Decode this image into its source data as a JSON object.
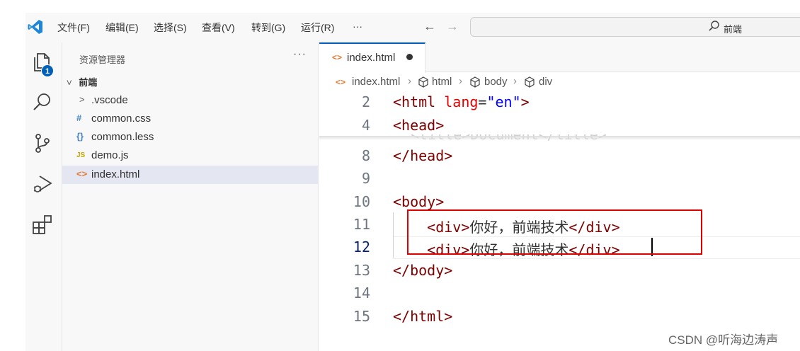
{
  "menu": [
    "文件(F)",
    "编辑(E)",
    "选择(S)",
    "查看(V)",
    "转到(G)",
    "运行(R)",
    "···"
  ],
  "nav": {
    "back": "←",
    "forward": "→"
  },
  "search": {
    "text": "前端"
  },
  "activity": {
    "explorer_badge": "1"
  },
  "sidebar": {
    "title": "资源管理器",
    "more": "···",
    "folder": "前端",
    "items": [
      {
        "icon": ">",
        "label": ".vscode",
        "icon_color": "#555555"
      },
      {
        "icon": "#",
        "label": "common.css",
        "icon_color": "#4a86c7"
      },
      {
        "icon": "{}",
        "label": "common.less",
        "icon_color": "#4a86c7"
      },
      {
        "icon": "JS",
        "label": "demo.js",
        "icon_color": "#c5a300"
      },
      {
        "icon": "<>",
        "label": "index.html",
        "icon_color": "#e37933"
      }
    ]
  },
  "tab": {
    "label": "index.html"
  },
  "breadcrumb": [
    "index.html",
    "html",
    "body",
    "div"
  ],
  "code": {
    "ghost": "<title>Document</title>",
    "lines": [
      {
        "n": "2",
        "tokens": [
          [
            "tag",
            "<html "
          ],
          [
            "attr",
            "lang"
          ],
          [
            "eq",
            "="
          ],
          [
            "str",
            "\"en\""
          ],
          [
            "tag",
            ">"
          ]
        ]
      },
      {
        "n": "4",
        "tokens": [
          [
            "tag",
            "<head>"
          ]
        ]
      },
      {
        "n": "8",
        "tokens": [
          [
            "tag",
            "</head>"
          ]
        ]
      },
      {
        "n": "9",
        "tokens": []
      },
      {
        "n": "10",
        "tokens": [
          [
            "tag",
            "<body>"
          ]
        ]
      },
      {
        "n": "11",
        "tokens": [
          [
            "tag",
            "    <div>"
          ],
          [
            "txt",
            "你好，前端技术"
          ],
          [
            "tag",
            "</div>"
          ]
        ]
      },
      {
        "n": "12",
        "tokens": [
          [
            "tag",
            "    <div>"
          ],
          [
            "txt",
            "你好，前端技术"
          ],
          [
            "tag",
            "</div>"
          ]
        ]
      },
      {
        "n": "13",
        "tokens": [
          [
            "tag",
            "</body>"
          ]
        ]
      },
      {
        "n": "14",
        "tokens": []
      },
      {
        "n": "15",
        "tokens": [
          [
            "tag",
            "</html>"
          ]
        ]
      }
    ],
    "active_line": "12"
  },
  "watermark": "CSDN @听海边涛声"
}
